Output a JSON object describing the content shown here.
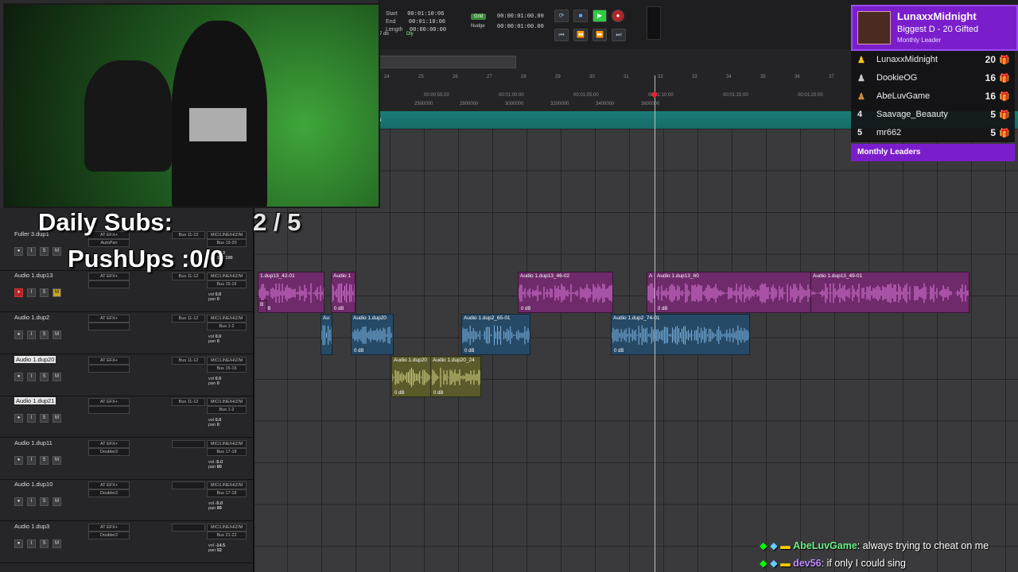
{
  "transport": {
    "start_label": "Start",
    "start_val": "00:01:10:06",
    "end_label": "End",
    "end_val": "00:01:10:06",
    "length_label": "Length",
    "length_val": "00:00:00:00",
    "grid_label": "Grid",
    "grid_val": "00:00:01:00.00",
    "nudge_label": "Nudge",
    "nudge_val": "00:00:01:00.00",
    "db_label": "7 db",
    "dly_label": "Dly"
  },
  "ruler": {
    "bars": [
      "24",
      "25",
      "26",
      "27",
      "28",
      "29",
      "30",
      "31",
      "32",
      "33",
      "34",
      "35",
      "36",
      "37"
    ],
    "timecodes": [
      "00:00:55:00",
      "00:01:00:00",
      "00:01:05:00",
      "00:01:10:00",
      "00:01:15:00",
      "00:01:20:00"
    ],
    "samples": [
      "2500000",
      "2800000",
      "3000000",
      "3200000",
      "3400000",
      "3600000"
    ]
  },
  "overlay": {
    "subs_label": "Daily Subs:",
    "subs_value": "2 / 5",
    "pushups": "PushUps :0/0"
  },
  "tracks": [
    {
      "name": "Fuller 3.dup1",
      "insert": "AT EFX+",
      "insert2": "AutoPan",
      "io_in": "Bus 11-12",
      "io_out": "Bus 19-20",
      "mic": "MIC/LINE/HIZ/M",
      "vol": "-37.2",
      "pan": "100 100",
      "mute": false,
      "rec": false,
      "selected": false
    },
    {
      "name": "Audio 1.dup13",
      "insert": "AT EFX+",
      "insert2": "",
      "io_in": "Bus 11-12",
      "io_out": "Bus 15-16",
      "mic": "MIC/LINE/HIZ/M",
      "vol": "0.0",
      "pan": "0",
      "mute": true,
      "rec": true,
      "selected": false
    },
    {
      "name": "Audio 1.dup2",
      "insert": "AT EFX+",
      "insert2": "",
      "io_in": "Bus 11-12",
      "io_out": "Bus 1-2",
      "mic": "MIC/LINE/HIZ/M",
      "vol": "0.0",
      "pan": "0",
      "mute": false,
      "rec": false,
      "selected": false
    },
    {
      "name": "Audio 1.dup20",
      "insert": "AT EFX+",
      "insert2": "",
      "io_in": "Bus 11-12",
      "io_out": "Bus 15-16",
      "mic": "MIC/LINE/HIZ/M",
      "vol": "0.0",
      "pan": "0",
      "mute": false,
      "rec": false,
      "selected": true
    },
    {
      "name": "Audio 1.dup21",
      "insert": "AT EFX+",
      "insert2": "",
      "io_in": "Bus 11-12",
      "io_out": "Bus 1-2",
      "mic": "MIC/LINE/HIZ/M",
      "vol": "0.0",
      "pan": "0",
      "mute": false,
      "rec": false,
      "selected": true
    },
    {
      "name": "Audio 1.dup11",
      "insert": "AT EFX+",
      "insert2": "Doubler2",
      "io_in": "",
      "io_out": "Bus 17-18",
      "mic": "MIC/LINE/HIZ/M",
      "vol": "-5.0",
      "pan": "80",
      "mute": false,
      "rec": false,
      "selected": false
    },
    {
      "name": "Audio 1.dup10",
      "insert": "AT EFX+",
      "insert2": "Doubler2",
      "io_in": "",
      "io_out": "Bus 17-18",
      "mic": "MIC/LINE/HIZ/M",
      "vol": "-5.0",
      "pan": "89",
      "mute": false,
      "rec": false,
      "selected": false
    },
    {
      "name": "Audio 1.dup3",
      "insert": "AT EFX+",
      "insert2": "Doubler2",
      "io_in": "",
      "io_out": "Bus 21-22",
      "mic": "MIC/LINE/HIZ/M",
      "vol": "-14.5",
      "pan": "52",
      "mute": false,
      "rec": false,
      "selected": false
    }
  ],
  "clips": {
    "c1": {
      "name": "1.dup13_42-01",
      "db": "0 dB"
    },
    "c2": {
      "name": "Audio 1",
      "db": "0 dB"
    },
    "c3": {
      "name": "Audio 1.dup13_46-02",
      "db": "0 dB"
    },
    "c4": {
      "name": "Audio 1.dup13_60",
      "db": "0 dB"
    },
    "c5": {
      "name": "Audio 1.dup13_49-01",
      "db": ""
    },
    "c6": {
      "name": "Au",
      "db": ""
    },
    "c7": {
      "name": "Audio 1.dup20",
      "db": "0 dB"
    },
    "c8": {
      "name": "Audio 1.dup2_65-01",
      "db": "0 dB"
    },
    "c9": {
      "name": "Audio 1.dup2_74-01",
      "db": "0 dB"
    },
    "c10": {
      "name": "Audio 1.dup20",
      "db": "0 dB"
    },
    "c11": {
      "name": "Audio 1.dup20_24",
      "db": "0 dB"
    },
    "c12": {
      "name": "B",
      "db": ""
    },
    "c13": {
      "name": "A",
      "db": ""
    }
  },
  "leaderboard": {
    "top_name": "LunaxxMidnight",
    "top_sub": "Biggest D - 20 Gifted",
    "top_role": "Monthly Leader",
    "rows": [
      {
        "rank": "",
        "name": "LunaxxMidnight",
        "count": "20"
      },
      {
        "rank": "",
        "name": "DookieOG",
        "count": "16"
      },
      {
        "rank": "",
        "name": "AbeLuvGame",
        "count": "16"
      },
      {
        "rank": "4",
        "name": "Saavage_Beaauty",
        "count": "5"
      },
      {
        "rank": "5",
        "name": "mr662",
        "count": "5"
      }
    ],
    "footer": "Monthly Leaders"
  },
  "chat": [
    {
      "user": "AbeLuvGame",
      "msg": ": always trying to cheat on me"
    },
    {
      "user": "dev56",
      "msg": ": if only I could sing"
    }
  ],
  "colors": {
    "accent": "#7a1ecc",
    "record": "#b02727",
    "play": "#2ecc40",
    "clip_pink": "#6e2a6a",
    "clip_blue": "#264a66",
    "clip_olive": "#5a5a2a"
  },
  "icons": [
    "play-icon",
    "stop-icon",
    "record-icon",
    "rewind-icon",
    "fast-forward-icon",
    "gift-icon",
    "trophy-icon",
    "crown-icon"
  ]
}
